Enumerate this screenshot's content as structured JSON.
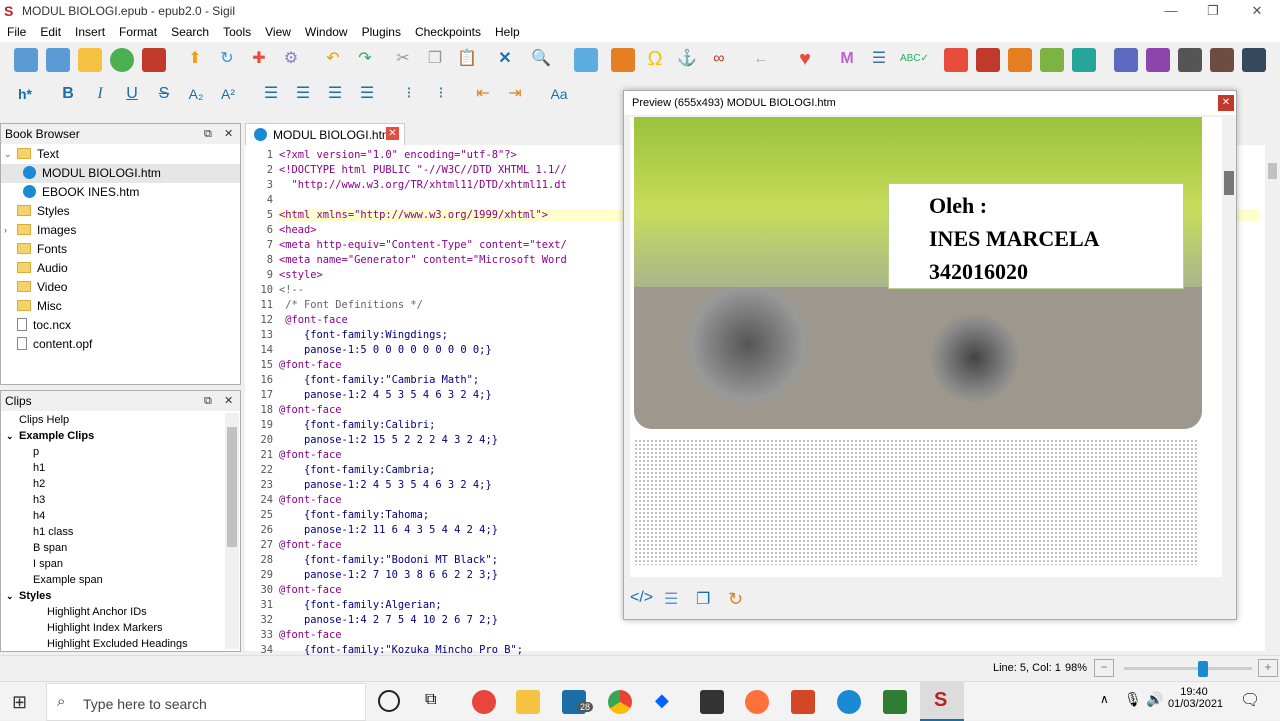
{
  "window": {
    "title": "MODUL BIOLOGI.epub - epub2.0 - Sigil",
    "app_icon": "S"
  },
  "menu": [
    "File",
    "Edit",
    "Insert",
    "Format",
    "Search",
    "Tools",
    "View",
    "Window",
    "Plugins",
    "Checkpoints",
    "Help"
  ],
  "toolbar2": {
    "heading_label": "h*",
    "bold": "B",
    "italic": "I",
    "underline": "U",
    "strike": "S",
    "sub": "A₂",
    "sup": "A²",
    "case": "Aa"
  },
  "book_browser": {
    "title": "Book Browser",
    "items": [
      {
        "label": "Text",
        "kind": "folder"
      },
      {
        "label": "MODUL BIOLOGI.htm",
        "kind": "html"
      },
      {
        "label": "EBOOK INES.htm",
        "kind": "html"
      },
      {
        "label": "Styles",
        "kind": "folder"
      },
      {
        "label": "Images",
        "kind": "folder"
      },
      {
        "label": "Fonts",
        "kind": "folder"
      },
      {
        "label": "Audio",
        "kind": "folder"
      },
      {
        "label": "Video",
        "kind": "folder"
      },
      {
        "label": "Misc",
        "kind": "folder"
      },
      {
        "label": "toc.ncx",
        "kind": "file"
      },
      {
        "label": "content.opf",
        "kind": "file"
      }
    ]
  },
  "clips": {
    "title": "Clips",
    "items": [
      {
        "label": "Clips Help",
        "bold": false
      },
      {
        "label": "Example Clips",
        "bold": true
      },
      {
        "label": "p",
        "bold": false
      },
      {
        "label": "h1",
        "bold": false
      },
      {
        "label": "h2",
        "bold": false
      },
      {
        "label": "h3",
        "bold": false
      },
      {
        "label": "h4",
        "bold": false
      },
      {
        "label": "h1 class",
        "bold": false
      },
      {
        "label": "B span",
        "bold": false
      },
      {
        "label": "I span",
        "bold": false
      },
      {
        "label": "Example span",
        "bold": false
      },
      {
        "label": "Styles",
        "bold": true
      },
      {
        "label": "Highlight Anchor IDs",
        "bold": false
      },
      {
        "label": "Highlight Index Markers",
        "bold": false
      },
      {
        "label": "Highlight Excluded Headings",
        "bold": false
      }
    ]
  },
  "editor_tab": "MODUL BIOLOGI.htm",
  "code_lines": [
    "<?xml version=\"1.0\" encoding=\"utf-8\"?>",
    "<!DOCTYPE html PUBLIC \"-//W3C//DTD XHTML 1.1//",
    "  \"http://www.w3.org/TR/xhtml11/DTD/xhtml11.dt",
    "",
    "<html xmlns=\"http://www.w3.org/1999/xhtml\">",
    "<head>",
    "<meta http-equiv=\"Content-Type\" content=\"text/",
    "<meta name=\"Generator\" content=\"Microsoft Word",
    "<style>",
    "<!--",
    " /* Font Definitions */",
    " @font-face",
    "    {font-family:Wingdings;",
    "    panose-1:5 0 0 0 0 0 0 0 0 0;}",
    "@font-face",
    "    {font-family:\"Cambria Math\";",
    "    panose-1:2 4 5 3 5 4 6 3 2 4;}",
    "@font-face",
    "    {font-family:Calibri;",
    "    panose-1:2 15 5 2 2 2 4 3 2 4;}",
    "@font-face",
    "    {font-family:Cambria;",
    "    panose-1:2 4 5 3 5 4 6 3 2 4;}",
    "@font-face",
    "    {font-family:Tahoma;",
    "    panose-1:2 11 6 4 3 5 4 4 2 4;}",
    "@font-face",
    "    {font-family:\"Bodoni MT Black\";",
    "    panose-1:2 7 10 3 8 6 6 2 2 3;}",
    "@font-face",
    "    {font-family:Algerian;",
    "    panose-1:4 2 7 5 4 10 2 6 7 2;}",
    "@font-face",
    "    {font-family:\"Kozuka Mincho Pro B\";"
  ],
  "preview": {
    "title": "Preview (655x493) MODUL BIOLOGI.htm",
    "author_label": "Oleh :",
    "author_name": "INES MARCELA",
    "author_id": "342016020"
  },
  "status": {
    "position": "Line: 5, Col: 1",
    "zoom": "98%",
    "zoom_level": 0.62
  },
  "taskbar": {
    "search_placeholder": "Type here to search",
    "time": "19:40",
    "date": "01/03/2021",
    "mail_badge": "28"
  }
}
